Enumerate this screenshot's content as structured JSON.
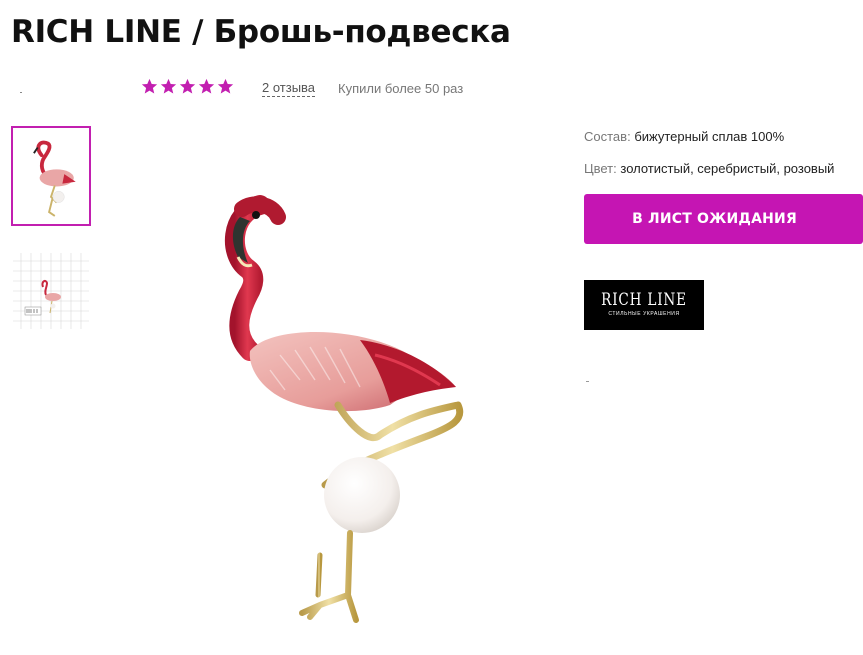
{
  "product": {
    "title": "RICH LINE / Брошь-подвеска",
    "rating": 5,
    "reviews_label": "2 отзыва",
    "purchases_label": "Купили более 50 раз"
  },
  "gallery": {
    "thumbnails": [
      {
        "alt": "flamingo-brooch-thumbnail",
        "selected": true
      },
      {
        "alt": "flamingo-brooch-size-grid-thumbnail",
        "selected": false
      }
    ]
  },
  "specs": [
    {
      "label": "Состав:",
      "value": "бижутерный сплав 100%"
    },
    {
      "label": "Цвет:",
      "value": "золотистый, серебристый, розовый"
    }
  ],
  "actions": {
    "waitlist_label": "В лист ожидания"
  },
  "brand": {
    "logo_name": "RICH LINE",
    "logo_tagline": "стильные украшения"
  },
  "colors": {
    "accent": "#c515b3",
    "star": "#c21fb0",
    "logo_bg": "#000000"
  }
}
